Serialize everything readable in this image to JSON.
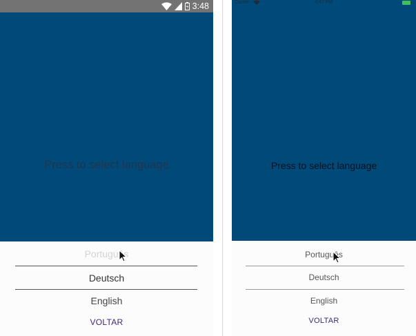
{
  "android": {
    "status_time": "3:48",
    "prompt": "Press to select language",
    "options": [
      "Português",
      "Deutsch",
      "English"
    ],
    "action_label": "VOLTAR"
  },
  "ios": {
    "carrier": "Carrier",
    "status_time": "4:47 PM",
    "prompt": "Press to select language",
    "options": [
      "Português",
      "Deutsch",
      "English"
    ],
    "action_label": "VOLTAR"
  },
  "colors": {
    "screen_bg": "#004a7a",
    "picker_bg": "#fcfcfd",
    "action": "#3c2a73",
    "battery_ios": "#3ec35a"
  }
}
